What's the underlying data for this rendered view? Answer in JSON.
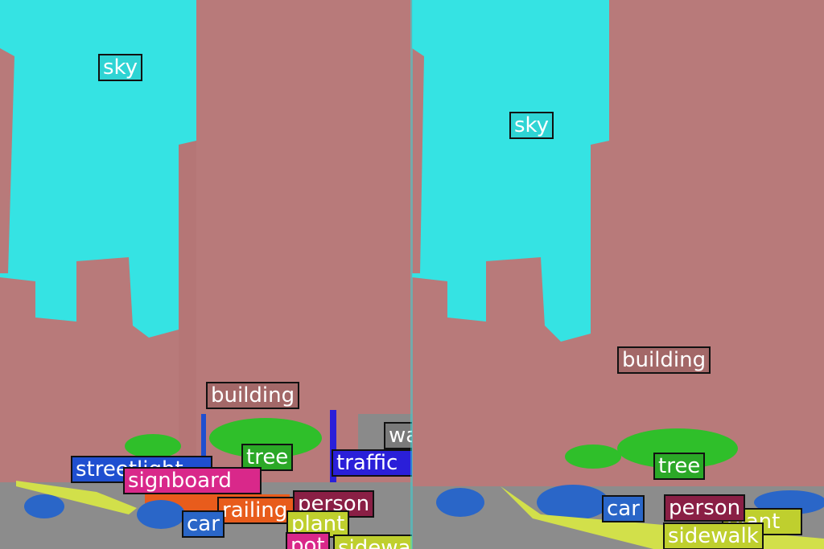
{
  "colors": {
    "sky": "#35e3e3",
    "building": "#b87a7a",
    "tree": "#2fbf2a",
    "streetlight": "#1f4fd0",
    "signboard": "#d9288a",
    "traffic": "#2a1fd9",
    "railing": "#e85c1c",
    "person": "#8a1f45",
    "car": "#2a66c8",
    "plant": "#cfe03a",
    "sidewalk": "#d2e04a",
    "wall": "#8a8a8a",
    "road": "#8c8c8c"
  },
  "left": {
    "labels": {
      "sky": "sky",
      "building": "building",
      "tree": "tree",
      "streetlight": "streetlight",
      "signboard": "signboard",
      "traffic": "traffic",
      "railing": "railing",
      "person": "person",
      "car": "car",
      "plant": "plant",
      "pot": "pot",
      "sidewalk": "sidewa",
      "wall": "wa"
    }
  },
  "right": {
    "labels": {
      "sky": "sky",
      "building": "building",
      "tree": "tree",
      "car": "car",
      "person": "person",
      "plant": "plant",
      "sidewalk": "sidewalk"
    }
  }
}
